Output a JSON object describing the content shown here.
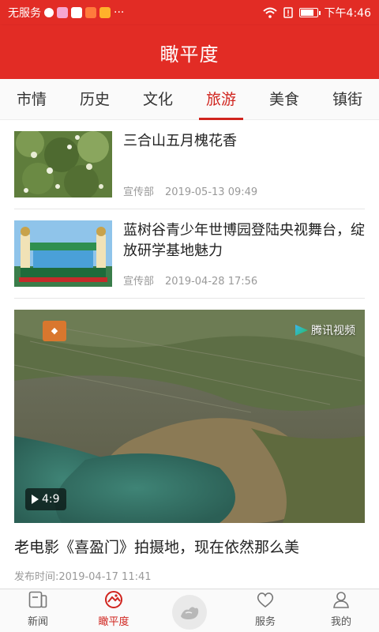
{
  "status_bar": {
    "carrier": "无服务",
    "more": "···",
    "time": "下午4:46",
    "battery_level": 0.85
  },
  "header": {
    "title": "瞰平度"
  },
  "tabs": [
    {
      "label": "市情",
      "active": false
    },
    {
      "label": "历史",
      "active": false
    },
    {
      "label": "文化",
      "active": false
    },
    {
      "label": "旅游",
      "active": true
    },
    {
      "label": "美食",
      "active": false
    },
    {
      "label": "镇街",
      "active": false
    }
  ],
  "news": [
    {
      "title": "三合山五月槐花香",
      "source": "宣传部",
      "date": "2019-05-13 09:49"
    },
    {
      "title": "蓝树谷青少年世博园登陆央视舞台，绽放研学基地魅力",
      "source": "宣传部",
      "date": "2019-04-28 17:56"
    }
  ],
  "video": {
    "duration": "4:9",
    "badge": "腾讯视频",
    "title": "老电影《喜盈门》拍摄地，现在依然那么美",
    "meta": "发布时间:2019-04-17 11:41"
  },
  "bottom_nav": [
    {
      "label": "新闻",
      "icon": "news-icon"
    },
    {
      "label": "瞰平度",
      "icon": "pingdu-icon"
    },
    {
      "label": "",
      "icon": "center-hand-icon"
    },
    {
      "label": "服务",
      "icon": "heart-icon"
    },
    {
      "label": "我的",
      "icon": "user-icon"
    }
  ],
  "colors": {
    "brand_red": "#e22c25",
    "active_red": "#d0241e"
  }
}
